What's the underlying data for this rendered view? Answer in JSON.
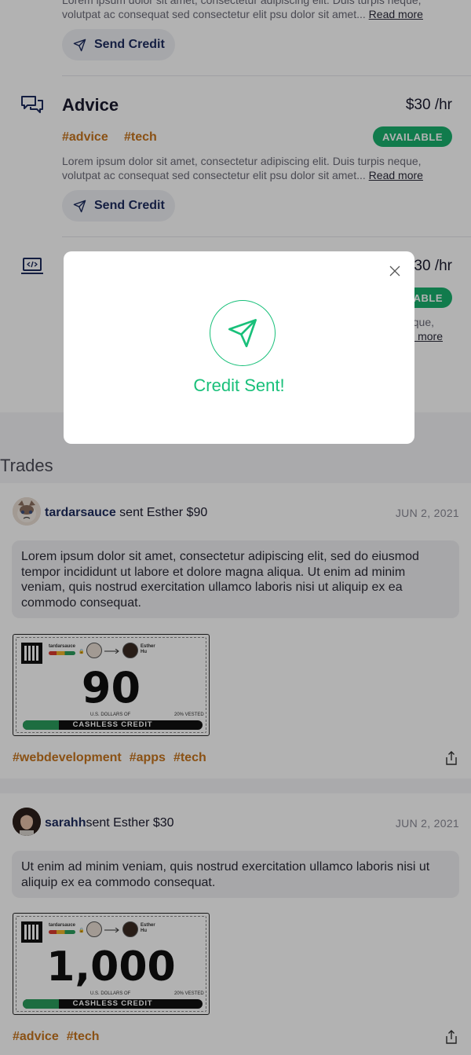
{
  "services": [
    {
      "title": "",
      "description": "Lorem ipsum dolor sit amet, consectetur adipiscing elit. Duis turpis neque, volutpat ac consequat sed consectetur  elit psu dolor sit amet...",
      "read_more": "Read more",
      "send_label": "Send Credit"
    },
    {
      "title": "Advice",
      "price": "$30 /hr",
      "tags": [
        "#advice",
        "#tech"
      ],
      "status": "AVAILABLE",
      "description": "Lorem ipsum dolor sit amet, consectetur adipiscing elit. Duis turpis neque, volutpat ac consequat sed consectetur  elit psu dolor sit amet...",
      "read_more": "Read more",
      "send_label": "Send Credit",
      "icon": "chat-bubbles-icon"
    },
    {
      "price": "$30 /hr",
      "status": "AVAILABLE",
      "description": "...que,",
      "read_more": "Read more",
      "icon": "laptop-code-icon"
    }
  ],
  "trades": {
    "heading": "Trades",
    "items": [
      {
        "user": "tardarsauce",
        "action": " sent Esther $90",
        "date": "JUN 2, 2021",
        "message": "Lorem ipsum dolor sit amet, consectetur adipiscing elit, sed do eiusmod tempor incididunt ut labore et dolore magna aliqua. Ut enim ad minim veniam, quis nostrud exercitation ullamco laboris nisi ut aliquip ex ea commodo consequat.",
        "bill": {
          "amount": "90",
          "sender": "tardarsauce",
          "recipient": "Esther Hu",
          "currency_line": "U.S. DOLLARS OF",
          "vested": "20% VESTED",
          "vested_fraction": 0.2,
          "bar_label": "CASHLESS CREDIT"
        },
        "tags": [
          "#webdevelopment",
          "#apps",
          "#tech"
        ]
      },
      {
        "user": "sarahh",
        "action": "sent Esther $30",
        "date": "JUN 2, 2021",
        "message": "Ut enim ad minim veniam, quis nostrud exercitation ullamco laboris nisi ut aliquip ex ea commodo consequat.",
        "bill": {
          "amount": "1,000",
          "sender": "tardarsauce",
          "recipient": "Esther Hu",
          "currency_line": "U.S. DOLLARS OF",
          "vested": "20% VESTED",
          "vested_fraction": 0.2,
          "bar_label": "CASHLESS CREDIT"
        },
        "tags": [
          "#advice",
          "#tech"
        ]
      }
    ]
  },
  "modal": {
    "title": "Credit Sent!",
    "icon": "paper-plane-icon",
    "accent": "#19c07a"
  },
  "colors": {
    "tag": "#c6741e",
    "available": "#19b06d",
    "primary_text": "#1d2c5e"
  }
}
